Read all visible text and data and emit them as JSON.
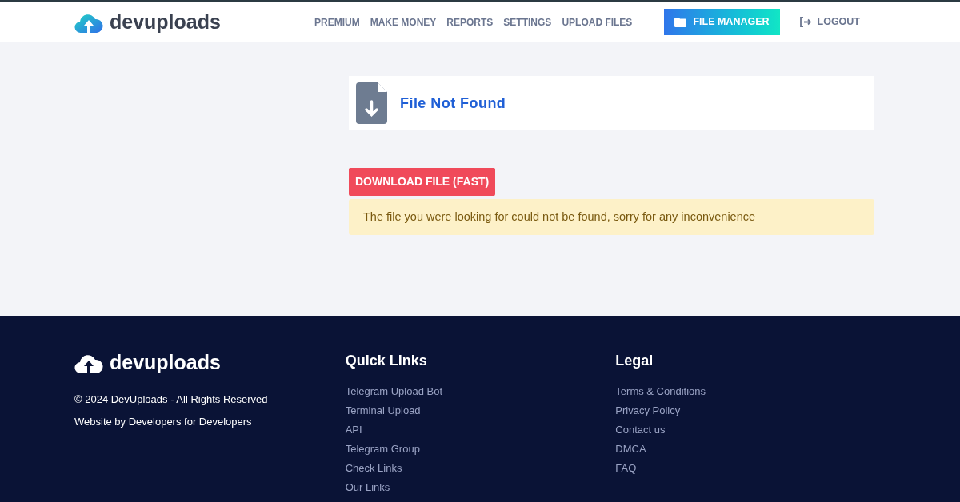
{
  "header": {
    "logo": "devuploads",
    "nav": [
      "PREMIUM",
      "MAKE MONEY",
      "REPORTS",
      "SETTINGS",
      "UPLOAD FILES"
    ],
    "file_manager": "FILE MANAGER",
    "logout": "LOGOUT"
  },
  "file_card": {
    "title": "File Not Found"
  },
  "download_button": "DOWNLOAD FILE (FAST)",
  "alert": "The file you were looking for could not be found, sorry for any inconvenience",
  "footer": {
    "logo": "devuploads",
    "copyright": "© 2024 DevUploads - All Rights Reserved",
    "tagline": "Website by Developers for Developers",
    "columns": [
      {
        "title": "Quick Links",
        "links": [
          "Telegram Upload Bot",
          "Terminal Upload",
          "API",
          "Telegram Group",
          "Check Links",
          "Our Links"
        ]
      },
      {
        "title": "Legal",
        "links": [
          "Terms & Conditions",
          "Privacy Policy",
          "Contact us",
          "DMCA",
          "FAQ"
        ]
      }
    ]
  }
}
